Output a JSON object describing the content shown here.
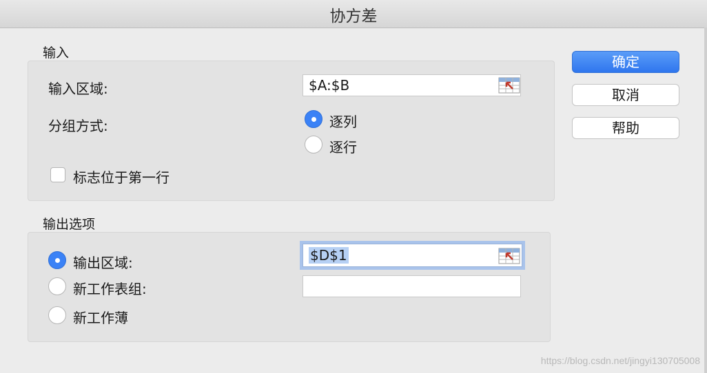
{
  "window": {
    "title": "协方差"
  },
  "input_section": {
    "label": "输入",
    "range_label": "输入区域:",
    "range_value": "$A:$B",
    "group_label": "分组方式:",
    "group_options": [
      "逐列",
      "逐行"
    ],
    "group_selected": "逐列",
    "labels_checkbox": "标志位于第一行",
    "labels_checked": false
  },
  "output_section": {
    "label": "输出选项",
    "options": [
      "输出区域:",
      "新工作表组:",
      "新工作薄"
    ],
    "selected": "输出区域:",
    "output_range_value": "$D$1",
    "new_sheet_value": ""
  },
  "buttons": {
    "ok": "确定",
    "cancel": "取消",
    "help": "帮助"
  },
  "watermark": "https://blog.csdn.net/jingyi130705008",
  "icons": {
    "range_picker": "range-select-icon"
  },
  "colors": {
    "accent": "#3b82f6",
    "focus_ring": "#a9c3eb"
  }
}
